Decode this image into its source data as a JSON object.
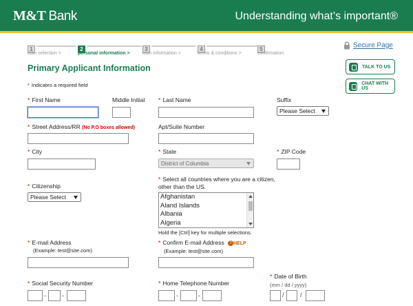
{
  "header": {
    "logo_mt": "M&T",
    "logo_bank": "Bank",
    "tagline": "Understanding what’s important®"
  },
  "steps": [
    {
      "num": "1",
      "label": "loan selection >"
    },
    {
      "num": "2",
      "label": "personal information >"
    },
    {
      "num": "3",
      "label": "loan information >"
    },
    {
      "num": "4",
      "label": "terms & conditions >"
    },
    {
      "num": "5",
      "label": "confirmation"
    }
  ],
  "sidebar": {
    "secure_page": "Secure Page",
    "talk_to_us": "TALK TO US",
    "chat_with_us": "CHAT WITH US"
  },
  "form": {
    "title": "Primary Applicant Information",
    "required_note": "Indicates a required field",
    "req_mark": "*",
    "first_name": "First Name",
    "middle_initial": "Middle Initial",
    "last_name": "Last Name",
    "suffix": "Suffix",
    "suffix_value": "Please Select",
    "street": "Street Address/RR",
    "street_note": "(No P.O boxes allowed)",
    "apt": "Apt/Suite Number",
    "city": "City",
    "state": "State",
    "state_value": "District of Columbia",
    "zip": "ZIP Code",
    "citizenship": "Citizenship",
    "citizenship_value": "Please Select",
    "countries_label_1": "Select all countries where you are a citizen,",
    "countries_label_2": "other than the US.",
    "countries": [
      "Afghanistan",
      "Aland Islands",
      "Albania",
      "Algeria"
    ],
    "ctrl_note": "Hold the [Ctrl] key for multiple selections.",
    "email": "E-mail Address",
    "email_example": "(Example: test@site.com)",
    "confirm_email": "Confirm E-mail Address",
    "confirm_email_example": "(Example: test@site.com)",
    "help": "HELP",
    "ssn": "Social Security Number",
    "home_phone": "Home Telephone Number",
    "dob": "Date of Birth",
    "dob_format": "(mm / dd / yyyy)",
    "dash": "-",
    "slash": "/"
  }
}
